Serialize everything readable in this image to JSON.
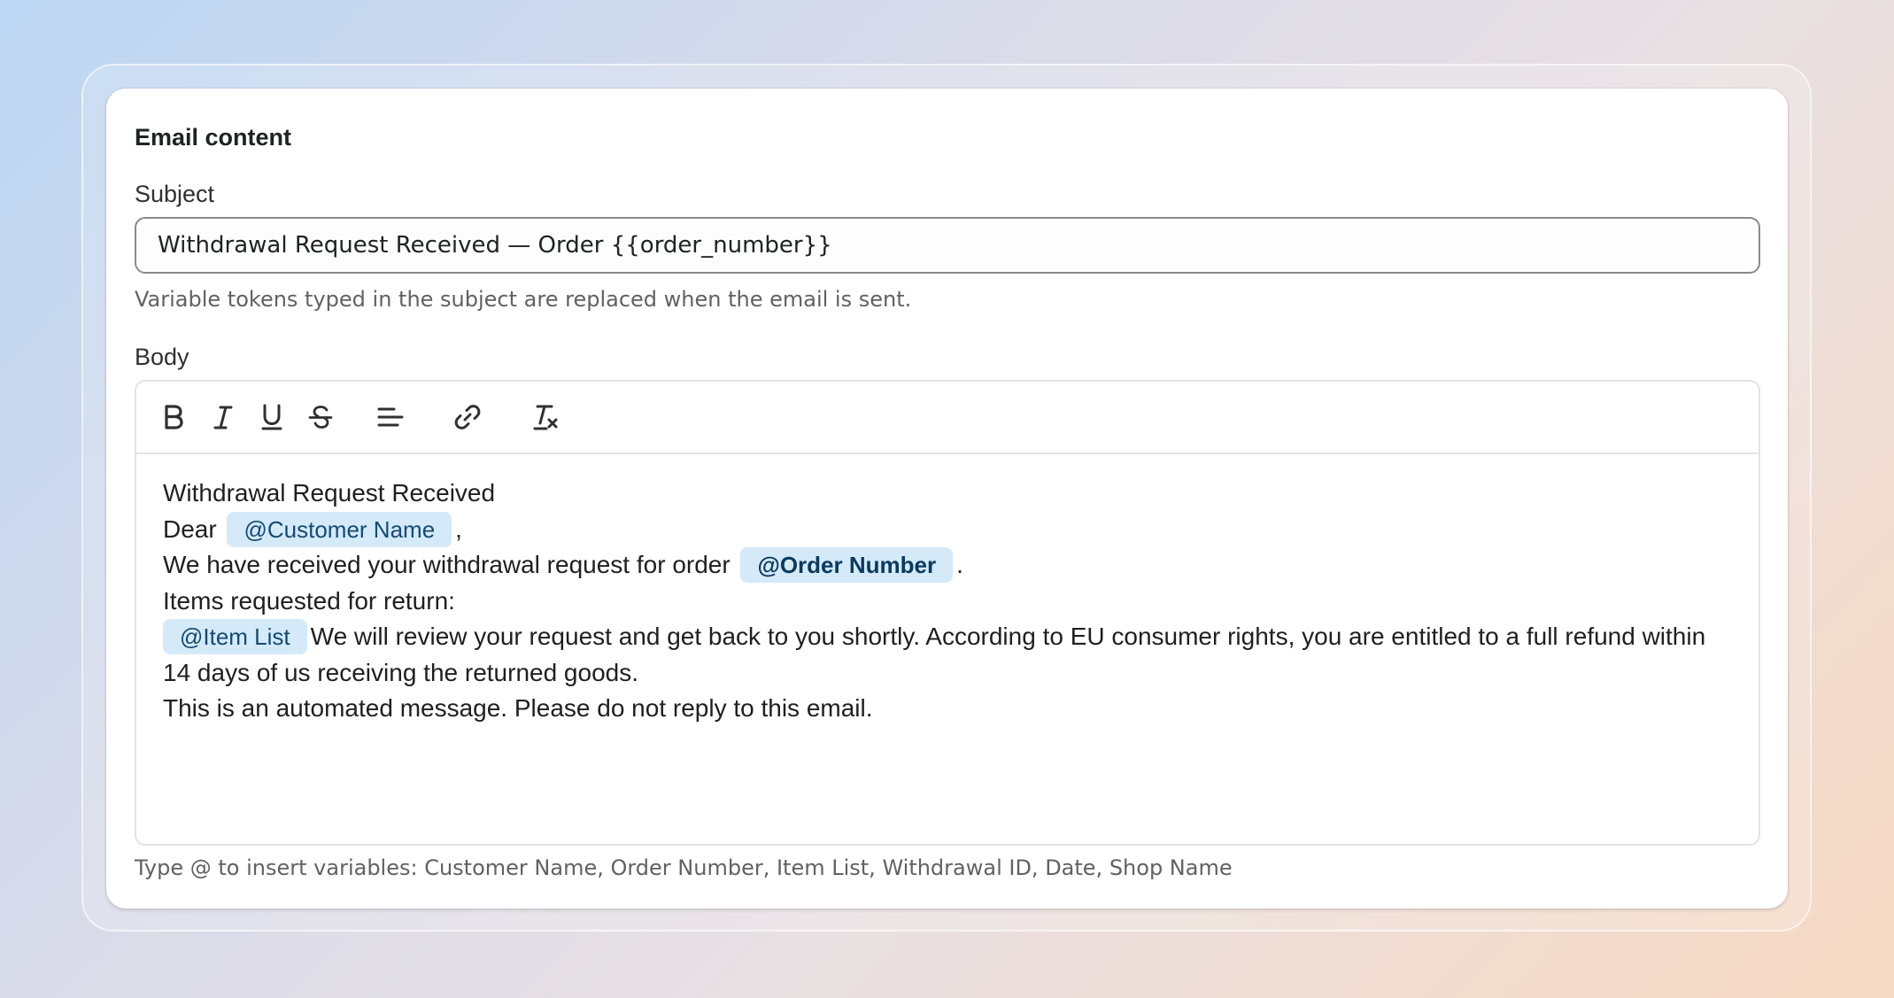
{
  "card": {
    "title": "Email content"
  },
  "subject": {
    "label": "Subject",
    "value": "Withdrawal Request Received — Order {{order_number}}",
    "help": "Variable tokens typed in the subject are replaced when the email is sent."
  },
  "body": {
    "label": "Body",
    "toolbar": [
      "bold-icon",
      "italic-icon",
      "underline-icon",
      "strikethrough-icon",
      "align-left-icon",
      "link-icon",
      "clear-format-icon"
    ],
    "heading": "Withdrawal Request Received",
    "dear": "Dear",
    "customer_token": "@Customer Name",
    "comma": ",",
    "received_text": "We have received your withdrawal request for order",
    "order_token": "@Order Number",
    "period": ".",
    "items_intro": "Items requested for return:",
    "item_token": "@Item List",
    "review_text": "We will review your request and get back to you shortly. According to EU consumer rights, you are entitled to a full refund within 14 days of us receiving the returned goods.",
    "footer_text": "This is an automated message. Please do not reply to this email.",
    "help": "Type @ to insert variables: Customer Name, Order Number, Item List, Withdrawal ID, Date, Shop Name"
  },
  "colors": {
    "token_bg": "#d4eaf9",
    "token_text": "#144a73"
  }
}
